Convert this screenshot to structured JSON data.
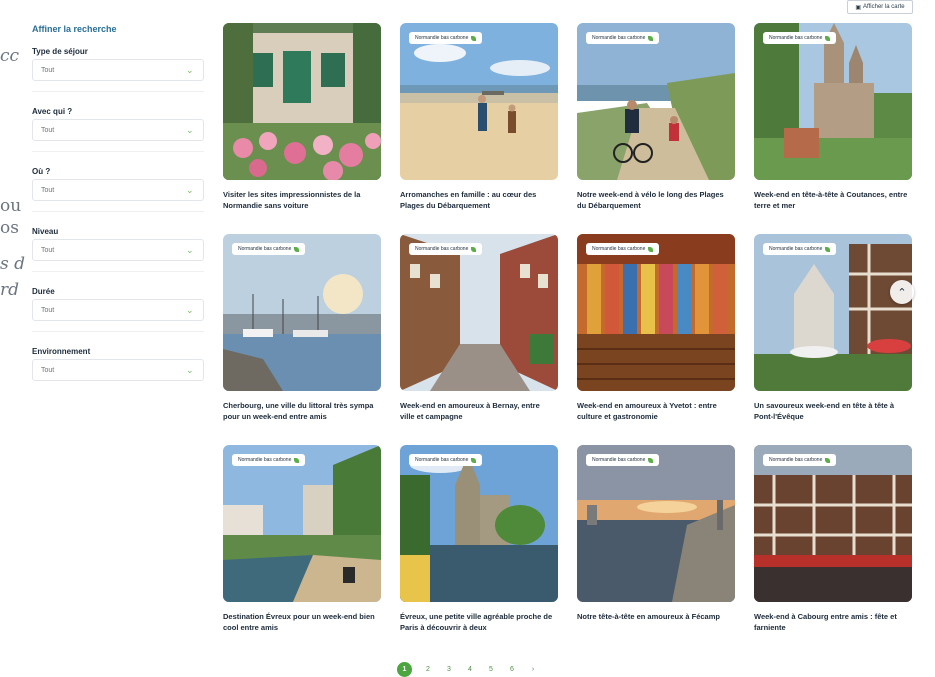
{
  "left_fragments": [
    "cc",
    "ou",
    "os",
    "s d",
    "rd"
  ],
  "top_button": {
    "label": "Afficher la carte",
    "icon": "map-icon"
  },
  "sidebar": {
    "title": "Affiner la recherche",
    "filters": [
      {
        "label": "Type de séjour",
        "value": "Tout"
      },
      {
        "label": "Avec qui ?",
        "value": "Tout"
      },
      {
        "label": "Où ?",
        "value": "Tout"
      },
      {
        "label": "Niveau",
        "value": "Tout"
      },
      {
        "label": "Durée",
        "value": "Tout"
      },
      {
        "label": "Environnement",
        "value": "Tout"
      }
    ]
  },
  "badge_label": "Normandie bas carbone",
  "cards": [
    {
      "title": "Visiter les sites impressionnistes de la Normandie sans voiture",
      "badge": false
    },
    {
      "title": "Arromanches en famille : au cœur des Plages du Débarquement",
      "badge": true
    },
    {
      "title": "Notre week-end à vélo le long des Plages du Débarquement",
      "badge": true
    },
    {
      "title": "Week-end en tête-à-tête à Coutances, entre terre et mer",
      "badge": true
    },
    {
      "title": "Cherbourg, une ville du littoral très sympa pour un week-end entre amis",
      "badge": true
    },
    {
      "title": "Week-end en amoureux à Bernay, entre ville et campagne",
      "badge": true
    },
    {
      "title": "Week-end en amoureux à Yvetot : entre culture et gastronomie",
      "badge": true
    },
    {
      "title": "Un savoureux week-end en tête à tête à Pont-l'Évêque",
      "badge": true
    },
    {
      "title": "Destination Évreux pour un week-end bien cool entre amis",
      "badge": true
    },
    {
      "title": "Évreux, une petite ville agréable proche de Paris à découvrir à deux",
      "badge": true
    },
    {
      "title": "Notre tête-à-tête en amoureux à Fécamp",
      "badge": true
    },
    {
      "title": "Week-end à Cabourg entre amis : fête et farniente",
      "badge": true
    }
  ],
  "pagination": {
    "pages": [
      "1",
      "2",
      "3",
      "4",
      "5",
      "6"
    ],
    "current": "1",
    "next": "›"
  },
  "colors": {
    "accent_green": "#4ca63f",
    "title_blue": "#2a6f97",
    "text_dark": "#1d2b3a"
  }
}
